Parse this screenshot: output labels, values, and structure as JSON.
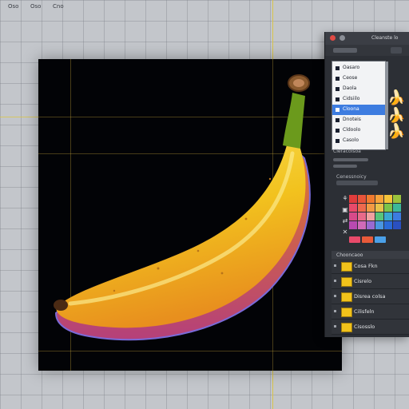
{
  "topbar": {
    "items": [
      "Oso",
      "Oso",
      "Cno"
    ]
  },
  "panel": {
    "title": "Cleanste lo",
    "list_items": [
      {
        "label": "Oasaro",
        "selected": false
      },
      {
        "label": "Ceose",
        "selected": false
      },
      {
        "label": "Daola",
        "selected": false
      },
      {
        "label": "Cidsiilo",
        "selected": false
      },
      {
        "label": "Cloona",
        "selected": true
      },
      {
        "label": "Dnoteis",
        "selected": false
      },
      {
        "label": "Cldoolo",
        "selected": false
      },
      {
        "label": "Casolo",
        "selected": false
      }
    ],
    "sections": {
      "properties_label": "Cleracolsoa",
      "palette_label": "Cenessnoicy",
      "layers_label": "Chooncaoo"
    },
    "tool_icons": [
      "droplet-icon",
      "lock-icon",
      "swap-icon",
      "close-icon"
    ],
    "swatches": [
      "#e03c3c",
      "#e8543a",
      "#f07a2e",
      "#f7a33a",
      "#f5c43a",
      "#9ac23c",
      "#e84a6a",
      "#ee6a4e",
      "#f29a44",
      "#e8c24a",
      "#7cc44a",
      "#3cb89a",
      "#d74a8a",
      "#e86a8a",
      "#f0a0a0",
      "#58c47a",
      "#3aa8d0",
      "#3c7ce0",
      "#b84ab0",
      "#d06ab8",
      "#9a6ad0",
      "#4a96e0",
      "#2a6ad8",
      "#2a50c0"
    ],
    "bottom_swatches": [
      "#e84a6a",
      "#e85a3a",
      "#4aa0e8"
    ],
    "layers": [
      {
        "label": "Cosa Fkn"
      },
      {
        "label": "Cisrelo"
      },
      {
        "label": "Disrea colsa"
      },
      {
        "label": "Cilisfeln"
      },
      {
        "label": "Cisosslo"
      }
    ]
  },
  "colors": {
    "canvas_bg": "#c3c6cb",
    "artboard_bg": "#020306",
    "banana_yellow": "#f2c21e",
    "banana_orange": "#e88f1e",
    "stem_green": "#6b9a1c",
    "selection_blue": "#3d7ce0",
    "panel_bg": "#2c2f35"
  }
}
